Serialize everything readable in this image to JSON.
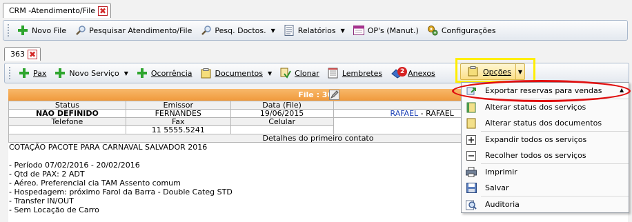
{
  "outer_tab": {
    "title": "CRM -Atendimento/File",
    "close_label": "✖"
  },
  "main_toolbar": {
    "novo_file": "Novo File",
    "pesquisar": "Pesquisar Atendimento/File",
    "pesq_doctos": "Pesq. Doctos.",
    "relatorios": "Relatórios",
    "ops": "OP's (Manut.)",
    "configuracoes": "Configurações"
  },
  "inner_tab": {
    "title": "363",
    "close_label": "✖"
  },
  "file_toolbar": {
    "pax": "Pax",
    "novo_servico": "Novo Serviço",
    "ocorrencia": "Ocorrência",
    "documentos": "Documentos",
    "clonar": "Clonar",
    "lembretes": "Lembretes",
    "anexos": "Anexos",
    "anexos_badge": "2",
    "opcoes": "Opções"
  },
  "file_header": {
    "title": "File : 363"
  },
  "info": {
    "h_status": "Status",
    "h_emissor": "Emissor",
    "h_data": "Data (File)",
    "h_cliente": "Clien",
    "status": "NÃO DEFINIDO",
    "emissor": "FERNANDES",
    "data": "19/06/2015",
    "cliente_a": "RAFAEL",
    "cliente_sep": " - ",
    "cliente_b": "RAFAEL",
    "h_telefone": "Telefone",
    "h_fax": "Fax",
    "h_celular": "Celular",
    "telefone": "",
    "fax": "11 5555.5241",
    "celular": "",
    "h_detalhes": "Detalhes do primeiro contato"
  },
  "notes": [
    "COTAÇÃO PACOTE PARA CARNAVAL SALVADOR 2016",
    "",
    "- Período 07/02/2016 - 20/02/2016",
    "- Qtd de PAX: 2 ADT",
    "- Aéreo. Preferencial cia TAM Assento comum",
    "- Hospedagem: próximo Farol da Barra - Double Categ STD",
    "- Transfer IN/OUT",
    "- Sem Locação de Carro"
  ],
  "menu": {
    "exportar": "Exportar reservas para vendas",
    "alterar_servicos": "Alterar status dos serviços",
    "alterar_documentos": "Alterar status dos documentos",
    "expandir": "Expandir todos os serviços",
    "recolher": "Recolher todos os serviços",
    "imprimir": "Imprimir",
    "salvar": "Salvar",
    "auditoria": "Auditoria"
  },
  "colors": {
    "accent_highlight": "#ffee00",
    "annotation_red": "#e01010",
    "file_header": "#f4a54a"
  }
}
